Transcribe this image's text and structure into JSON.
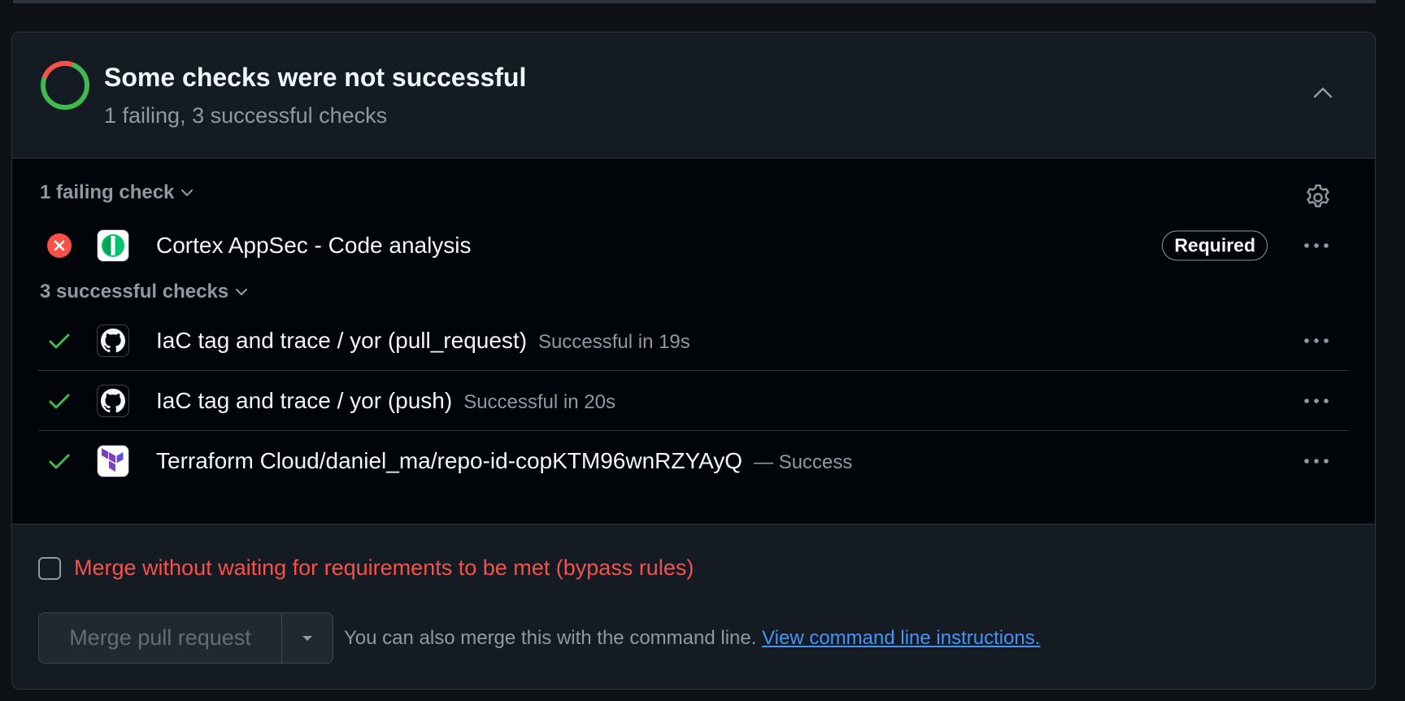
{
  "header": {
    "title": "Some checks were not successful",
    "subtitle": "1 failing, 3 successful checks",
    "ring_colors": {
      "fail": "#f85149",
      "success": "#3fb950"
    },
    "collapse_icon": "chevron-up-icon"
  },
  "failing_group": {
    "label": "1 failing check",
    "settings_icon": "gear-icon",
    "checks": [
      {
        "name": "Cortex AppSec - Code analysis",
        "badge": "Required",
        "status": "failure",
        "app_icon": "cortex-icon"
      }
    ]
  },
  "successful_group": {
    "label": "3 successful checks",
    "checks": [
      {
        "name": "IaC tag and trace / yor (pull_request)",
        "meta": "Successful in 19s",
        "status": "success",
        "app_icon": "github-icon"
      },
      {
        "name": "IaC tag and trace / yor (push)",
        "meta": "Successful in 20s",
        "status": "success",
        "app_icon": "github-icon"
      },
      {
        "name": "Terraform Cloud/daniel_ma/repo-id-copKTM96wnRZYAyQ",
        "meta": "— Success",
        "status": "success",
        "app_icon": "terraform-icon"
      }
    ]
  },
  "merge": {
    "bypass_label": "Merge without waiting for requirements to be met (bypass rules)",
    "bypass_checked": false,
    "button_label": "Merge pull request",
    "cli_note": "You can also merge this with the command line.",
    "cli_link": "View command line instructions."
  },
  "colors": {
    "danger": "#f85149",
    "success": "#3fb950",
    "link": "#4493f8",
    "muted": "#9198a1"
  }
}
